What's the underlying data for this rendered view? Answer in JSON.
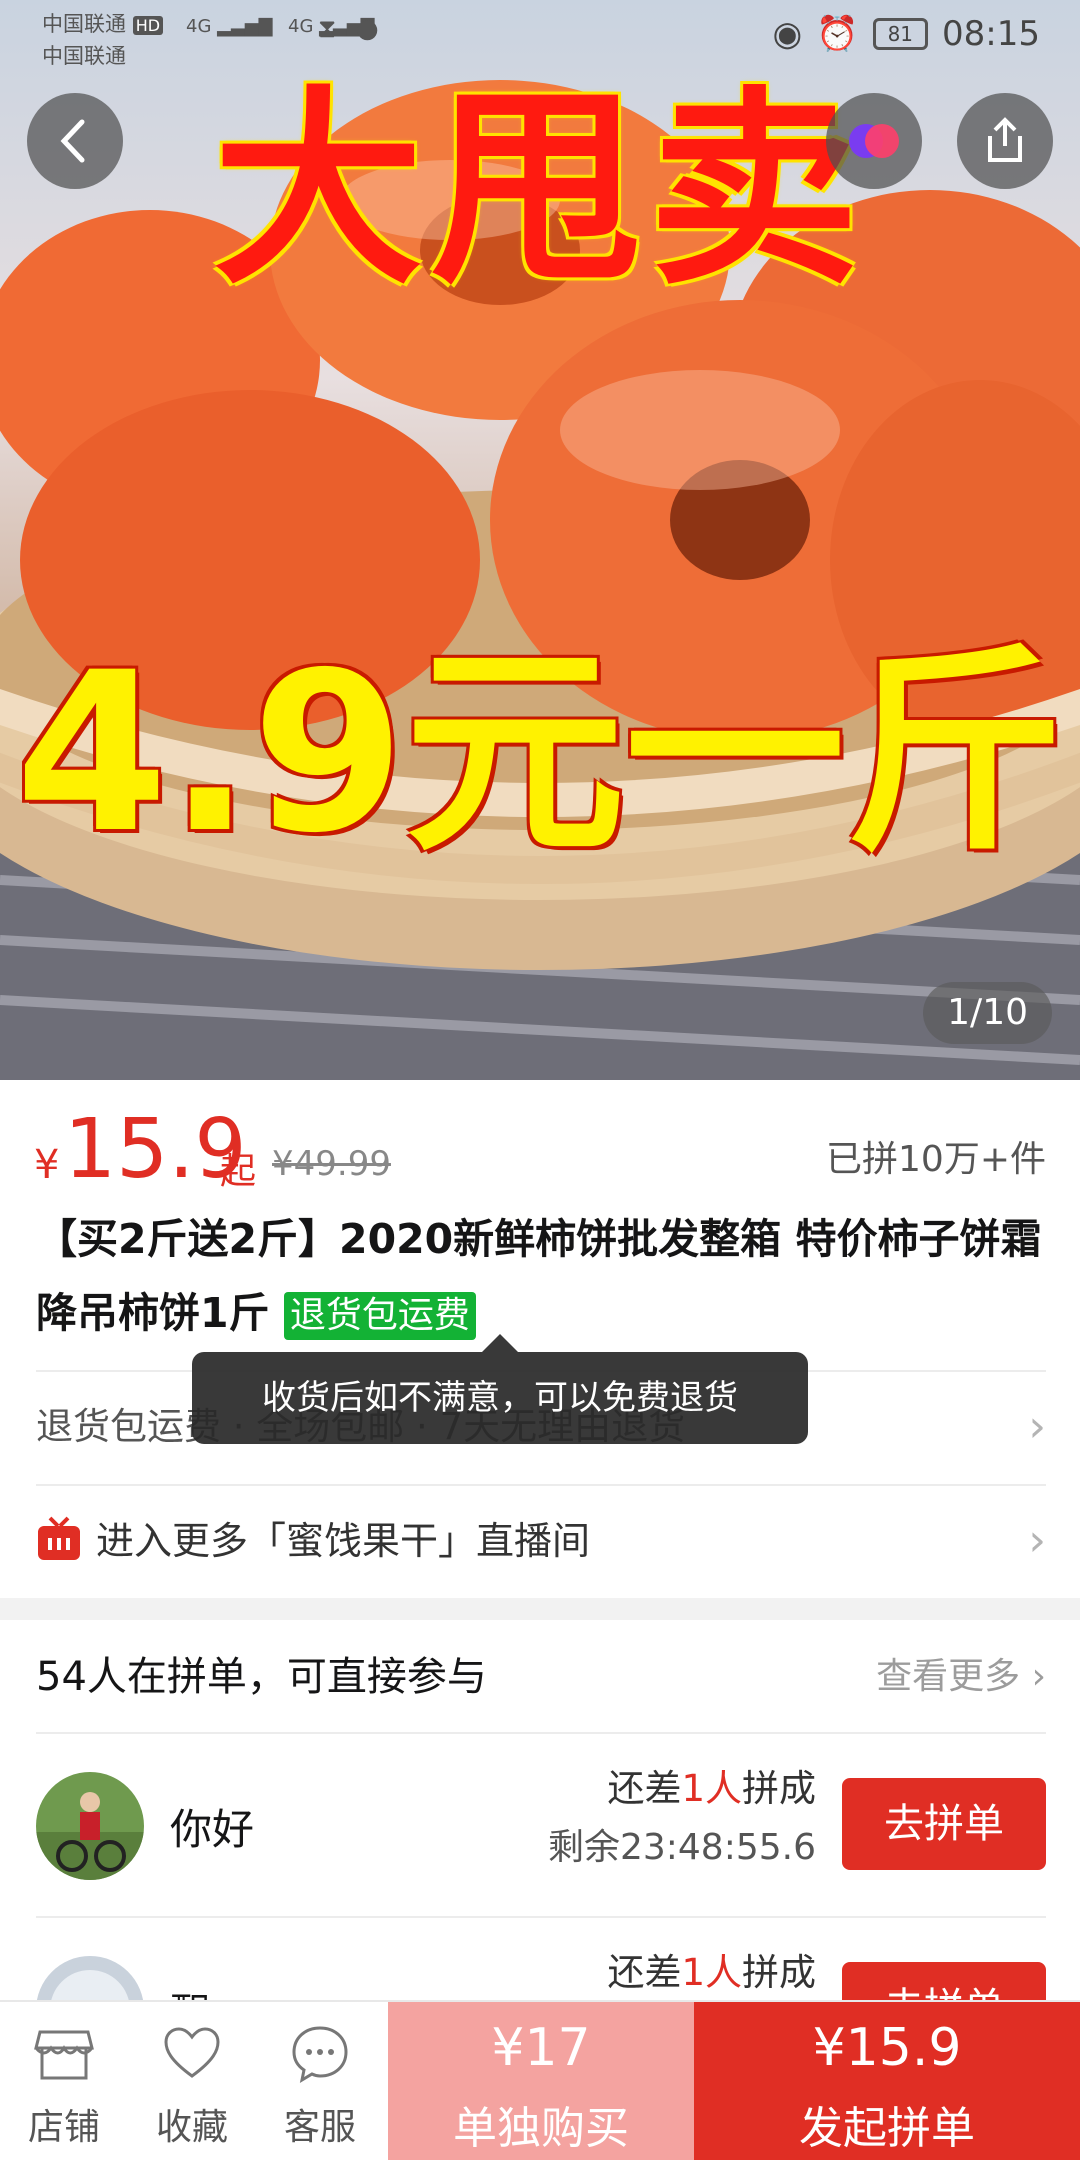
{
  "status_bar": {
    "carrier1": "中国联通",
    "carrier2": "中国联通",
    "hd": "HD",
    "net1": "4G",
    "net2": "4G",
    "battery": "81",
    "time": "08:15"
  },
  "hero": {
    "promo_top": "大甩卖",
    "promo_price": "4.9元一斤",
    "counter": "1/10"
  },
  "price": {
    "currency": "¥",
    "current": "15.9",
    "suffix": "起",
    "original": "¥49.99",
    "sold": "已拼10万+件"
  },
  "product": {
    "title": "【买2斤送2斤】2020新鲜柿饼批发整箱 特价柿子饼霜降吊柿饼1斤",
    "tag": "退货包运费"
  },
  "services": {
    "text": "退货包运费 · 全场包邮 · 7天无理由退货",
    "tooltip": "收货后如不满意，可以免费退货"
  },
  "live": {
    "text": "进入更多「蜜饯果干」直播间"
  },
  "group": {
    "title": "54人在拼单，可直接参与",
    "more": "查看更多",
    "items": [
      {
        "name": "你好",
        "need_prefix": "还差",
        "need_count": "1人",
        "need_suffix": "拼成",
        "remain": "剩余23:48:55.6",
        "button": "去拼单"
      },
      {
        "name": "飘",
        "need_prefix": "还差",
        "need_count": "1人",
        "need_suffix": "拼成",
        "remain": "",
        "button": "去拼单"
      }
    ]
  },
  "bottom_bar": {
    "store": "店铺",
    "favorite": "收藏",
    "service": "客服",
    "solo_price": "¥17",
    "solo_label": "单独购买",
    "group_price": "¥15.9",
    "group_label": "发起拼单"
  },
  "colors": {
    "accent": "#e02e24",
    "tag_green": "#13b235",
    "solo_bg": "#f4a3a0"
  }
}
